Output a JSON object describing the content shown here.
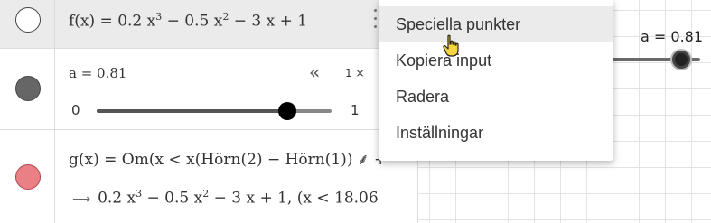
{
  "algebra": {
    "rows": [
      {
        "id": "f",
        "marble_color": "#ffffff",
        "definition": {
          "prefix": "f(x)  =  0.2 x",
          "exp1": "3",
          "mid1": " − 0.5 x",
          "exp2": "2",
          "suffix": " − 3 x + 1"
        }
      },
      {
        "id": "a",
        "marble_color": "#666666",
        "label": "a = 0.81",
        "min": "0",
        "max": "1",
        "value": 0.81,
        "rewind_icon": "double-chevron-left-icon",
        "speed_label": "1 ×"
      },
      {
        "id": "g",
        "marble_color": "#e88086",
        "definition": "g(x)  =  Om(x < x(Hörn(2) − Hörn(1)",
        "definition_tail": ") ⸙ +",
        "result": {
          "prefix": "0.2 x",
          "exp1": "3",
          "mid1": " − 0.5 x",
          "exp2": "2",
          "suffix": " − 3 x + 1,     (x < 18.06"
        }
      }
    ]
  },
  "graphics": {
    "slider_label": "a = 0.81",
    "slider_value": 0.81
  },
  "context_menu": {
    "items": [
      "Speciella punkter",
      "Kopiera input",
      "Radera",
      "Inställningar"
    ],
    "hovered_index": 0
  }
}
